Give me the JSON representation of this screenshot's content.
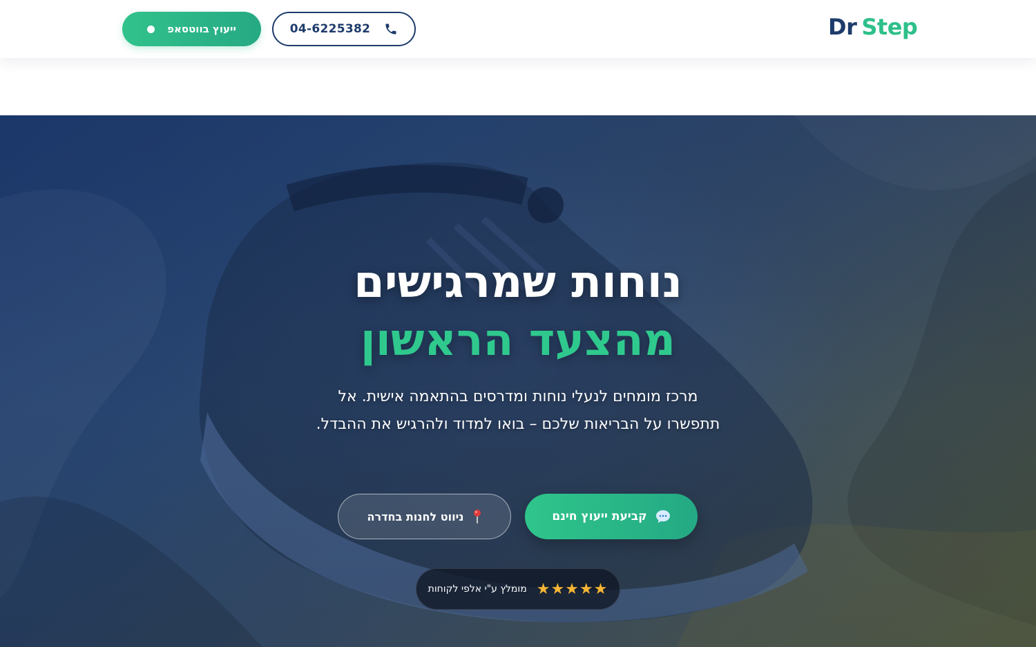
{
  "header": {
    "logo": {
      "part1": "Dr",
      "part2": "Step"
    },
    "phone": {
      "number": "04-6225382",
      "icon": "phone-icon"
    },
    "whatsapp": {
      "label": "ייעוץ בווטסאפ",
      "icon": "dot-icon"
    }
  },
  "hero": {
    "title_line1": "נוחות שמרגישים",
    "title_line2": "מהצעד הראשון",
    "subtitle": "מרכז מומחים לנעלי נוחות ומדרסים בהתאמה אישית. אל תתפשרו על הבריאות שלכם – בואו למדוד ולהרגיש את ההבדל.",
    "cta_primary": {
      "label": "קביעת ייעוץ חינם",
      "icon": "chat-bubble-icon"
    },
    "cta_secondary": {
      "label": "ניווט לחנות בחדרה",
      "icon": "map-pin-icon"
    },
    "rating": {
      "stars": "★★★★★",
      "label": "מומלץ ע\"י אלפי לקוחות",
      "star_count": 5
    }
  },
  "colors": {
    "brand_navy": "#1d3b6b",
    "brand_green": "#2ec08a",
    "star": "#f6b533"
  }
}
